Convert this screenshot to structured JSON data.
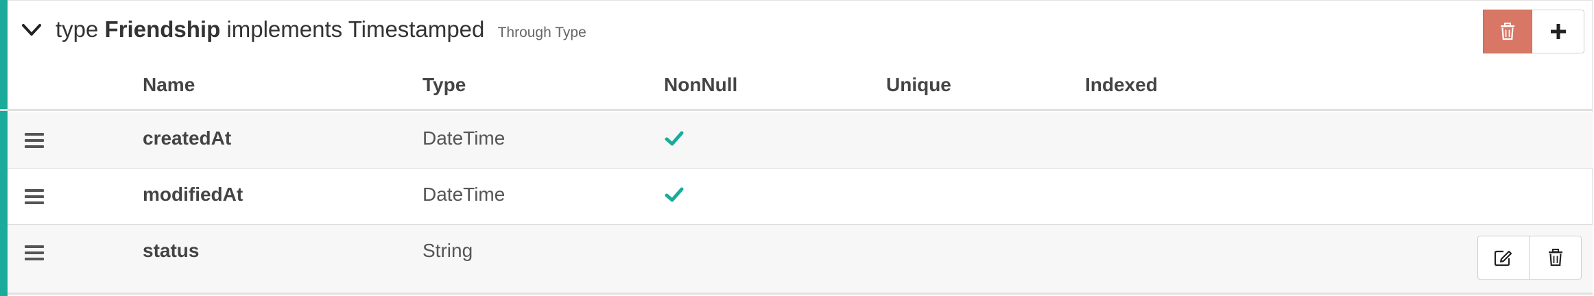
{
  "header": {
    "keyword": "type",
    "type_name": "Friendship",
    "implements_text": "implements Timestamped",
    "subtitle": "Through Type"
  },
  "columns": {
    "name": "Name",
    "type": "Type",
    "nonnull": "NonNull",
    "unique": "Unique",
    "indexed": "Indexed"
  },
  "rows": [
    {
      "name": "createdAt",
      "type": "DateTime",
      "nonnull": true,
      "unique": false,
      "indexed": false
    },
    {
      "name": "modifiedAt",
      "type": "DateTime",
      "nonnull": true,
      "unique": false,
      "indexed": false
    },
    {
      "name": "status",
      "type": "String",
      "nonnull": false,
      "unique": false,
      "indexed": false
    }
  ],
  "colors": {
    "accent": "#1aab9b",
    "danger": "#d97766",
    "check": "#1aab9b"
  },
  "icons": {
    "collapse": "chevron-down-icon",
    "delete_type": "trash-icon",
    "add_field": "plus-icon",
    "drag": "hamburger-icon",
    "edit_field": "edit-icon",
    "delete_field": "trash-icon",
    "nonnull_check": "check-icon"
  }
}
